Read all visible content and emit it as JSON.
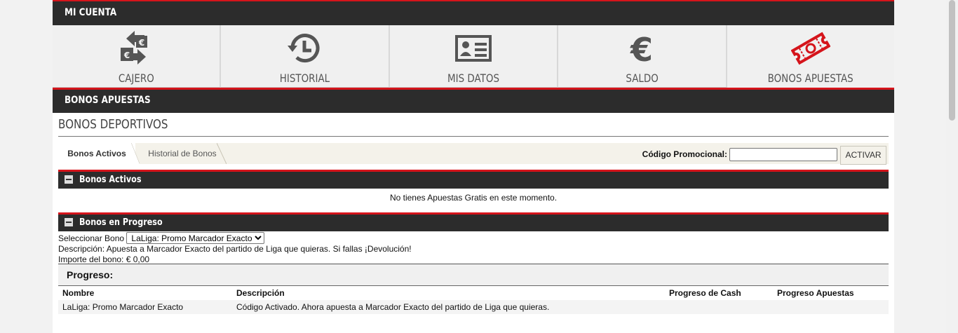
{
  "header": {
    "title": "MI CUENTA"
  },
  "nav": {
    "items": [
      {
        "label": "CAJERO",
        "icon": "cashier-exchange-icon"
      },
      {
        "label": "HISTORIAL",
        "icon": "history-clock-icon"
      },
      {
        "label": "MIS DATOS",
        "icon": "id-card-icon"
      },
      {
        "label": "SALDO",
        "icon": "euro-icon"
      },
      {
        "label": "BONOS APUESTAS",
        "icon": "ticket-icon",
        "active": true
      }
    ]
  },
  "section": {
    "title": "BONOS APUESTAS"
  },
  "page": {
    "title": "BONOS DEPORTIVOS"
  },
  "tabs": [
    {
      "label": "Bonos Activos",
      "selected": true
    },
    {
      "label": "Historial de Bonos",
      "selected": false
    }
  ],
  "promo": {
    "label": "Código Promocional:",
    "value": "",
    "button": "ACTIVAR"
  },
  "active_bonuses": {
    "title": "Bonos Activos",
    "empty_message": "No tienes Apuestas Gratis en este momento."
  },
  "in_progress": {
    "title": "Bonos en Progreso",
    "select_label": "Seleccionar Bono",
    "selected_bonus": "LaLiga: Promo Marcador Exacto",
    "description": "Descripción: Apuesta a Marcador Exacto del partido de Liga que quieras. Si fallas ¡Devolución!",
    "amount": "Importe del bono: € 0,00",
    "progress_title": "Progreso:",
    "columns": [
      "Nombre",
      "Descripción",
      "Progreso de Cash",
      "Progreso Apuestas"
    ],
    "rows": [
      [
        "LaLiga: Promo Marcador Exacto",
        "Código Activado. Ahora apuesta a Marcador Exacto del partido de Liga que quieras.",
        "",
        ""
      ]
    ]
  },
  "colors": {
    "accent": "#d5141b",
    "bar": "#2c2c2c",
    "tile": "#f0f0f0"
  }
}
